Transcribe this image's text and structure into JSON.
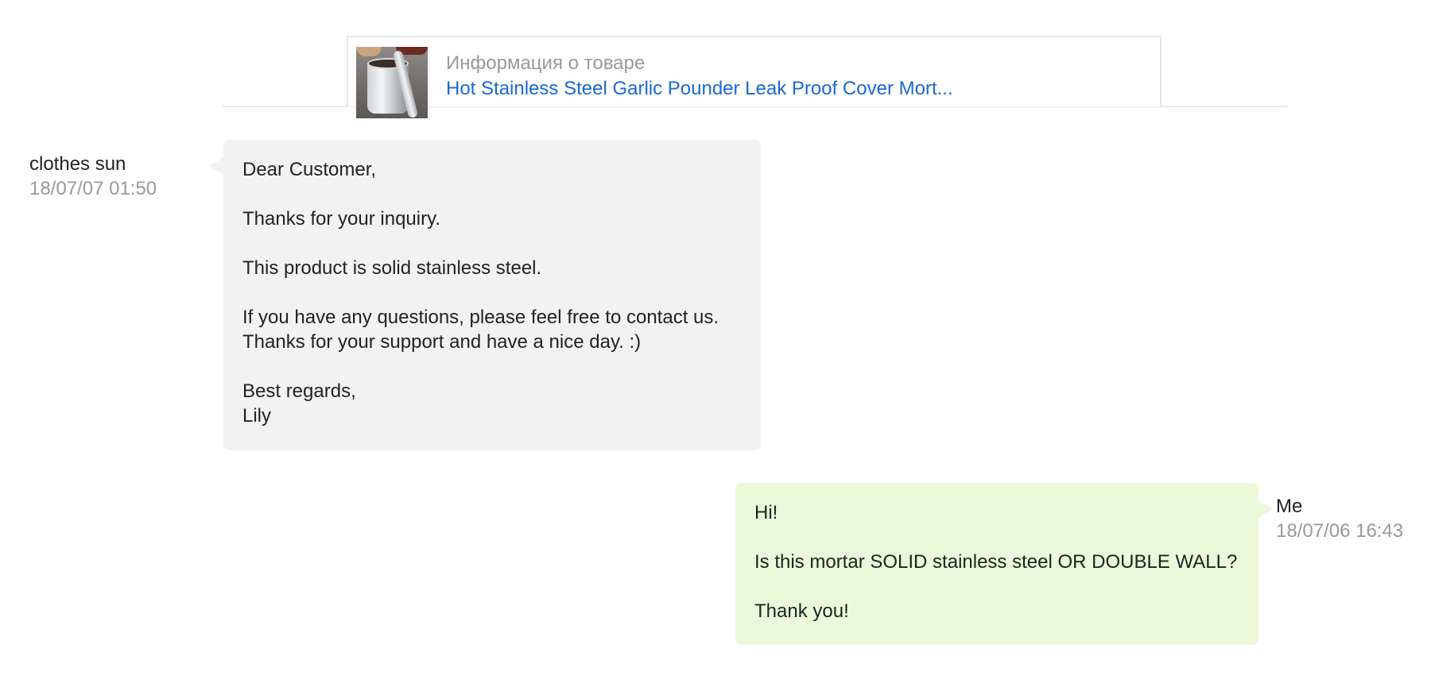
{
  "product": {
    "info_label": "Информация о товаре",
    "title": "Hot Stainless Steel Garlic Pounder Leak Proof Cover Mort..."
  },
  "messages": [
    {
      "sender": "clothes sun",
      "timestamp": "18/07/07 01:50",
      "direction": "incoming",
      "lines": [
        "Dear Customer,",
        "",
        "Thanks for your inquiry.",
        "",
        "This product is solid stainless steel.",
        "",
        "If you have any questions, please feel free to contact us.",
        "Thanks for your support and have a nice day. :)",
        "",
        "Best regards,",
        "Lily"
      ]
    },
    {
      "sender": "Me",
      "timestamp": "18/07/06 16:43",
      "direction": "outgoing",
      "lines": [
        "Hi!",
        "",
        "Is this mortar SOLID stainless steel OR DOUBLE WALL?",
        "",
        "Thank you!"
      ]
    }
  ],
  "colors": {
    "incoming_bubble": "#f2f2f2",
    "outgoing_bubble": "#ebf8da",
    "link": "#1a6ad0",
    "muted_text": "#999999"
  }
}
